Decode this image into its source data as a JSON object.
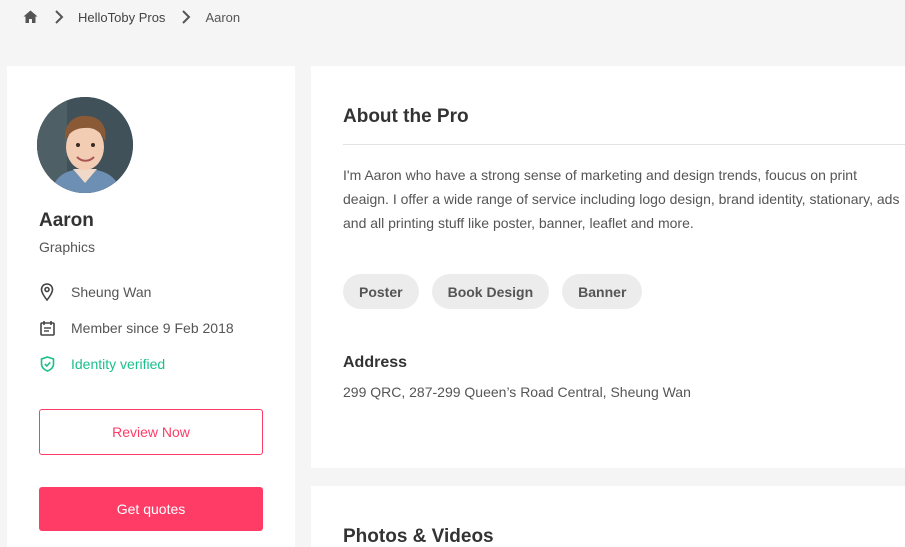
{
  "breadcrumb": {
    "home_icon": "home-icon",
    "items": [
      "HelloToby Pros",
      "Aaron"
    ]
  },
  "profile": {
    "name": "Aaron",
    "category": "Graphics",
    "location": "Sheung Wan",
    "member_since": "Member since 9 Feb 2018",
    "verified": "Identity verified",
    "review_button": "Review Now",
    "quote_button": "Get quotes"
  },
  "about": {
    "title": "About the Pro",
    "description": "I'm Aaron who have a strong sense of marketing and design trends, foucus on print deaign. I offer a wide range of service including logo design, brand identity, stationary, ads and all printing stuff like poster, banner, leaflet and more.",
    "tags": [
      "Poster",
      "Book Design",
      "Banner"
    ],
    "address_label": "Address",
    "address": "299 QRC, 287-299 Queen’s Road Central, Sheung Wan"
  },
  "media": {
    "title": "Photos & Videos"
  },
  "colors": {
    "accent": "#ff3c66",
    "verified": "#1cbf8b",
    "background": "#f5f5f5"
  }
}
